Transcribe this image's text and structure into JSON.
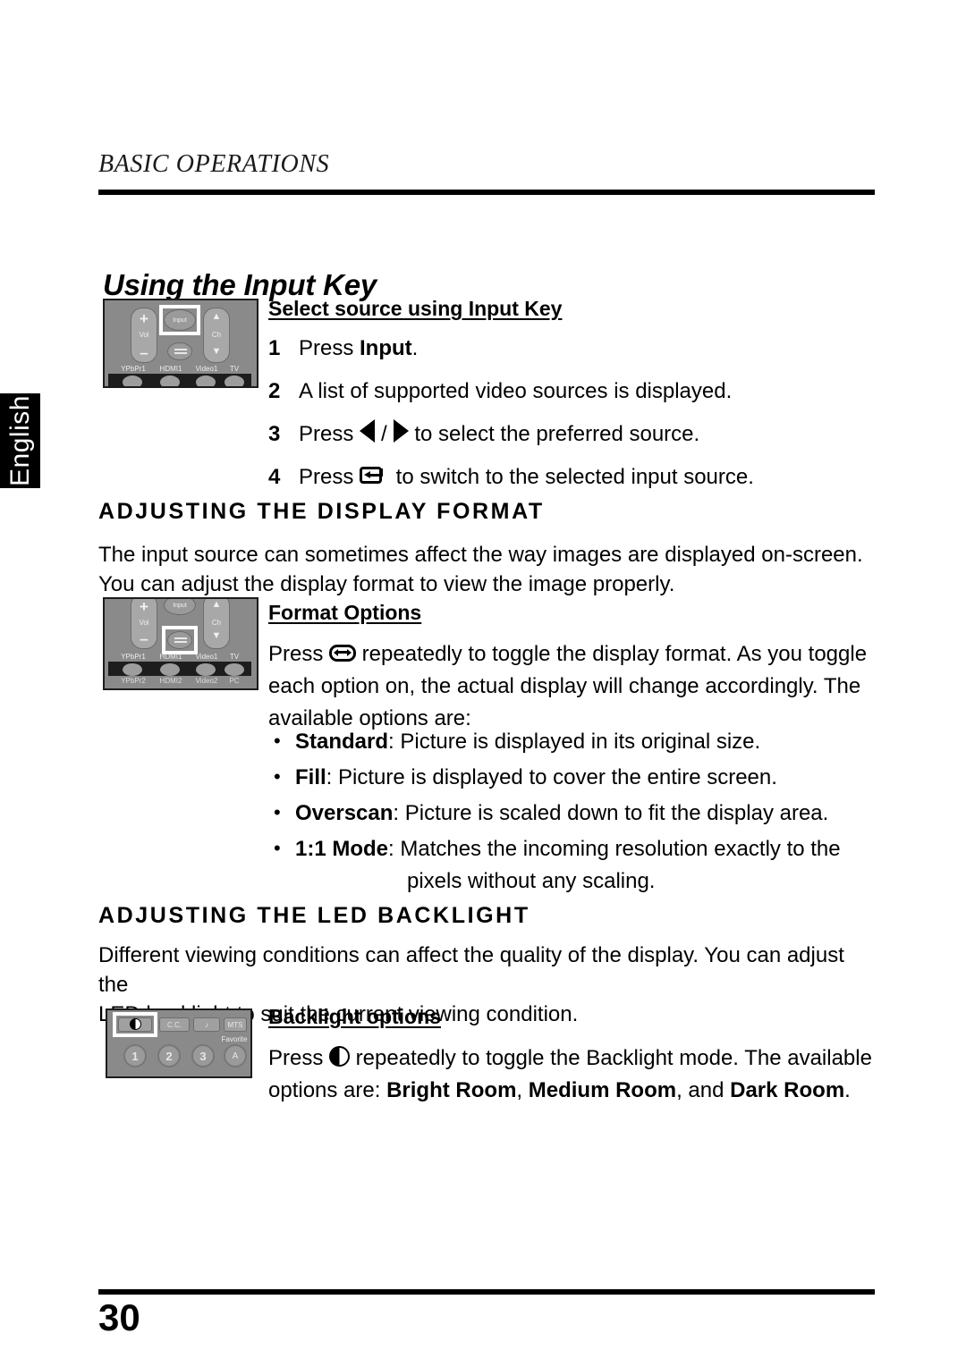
{
  "side_tab": {
    "language": "English"
  },
  "header": {
    "running_head": "BASIC OPERATIONS"
  },
  "title": "Using the Input Key",
  "input_key_section": {
    "subhead": "Select source using Input Key",
    "steps": [
      {
        "num": "1",
        "pre": "Press ",
        "bold": "Input",
        "post": "."
      },
      {
        "num": "2",
        "pre": "A list of supported video sources is displayed.",
        "bold": "",
        "post": ""
      },
      {
        "num": "3",
        "pre": "Press ",
        "icon": "left-right-triangles",
        "post": " to select the preferred source."
      },
      {
        "num": "4",
        "pre": "Press ",
        "icon": "enter-key",
        "post": " to switch to the selected input source."
      }
    ]
  },
  "display_format_section": {
    "heading": "ADJUSTING THE DISPLAY FORMAT",
    "intro_line1": "The input source can sometimes affect the way images are displayed on-screen.",
    "intro_line2": "You can adjust the display format to view the image properly.",
    "subhead": "Format Options",
    "press_pre": "Press ",
    "press_post_line1": " repeatedly to toggle the display format. As you toggle",
    "press_post_line2": "each option on, the actual display will change accordingly. The",
    "press_post_line3": "available options are:",
    "options": [
      {
        "name": "Standard",
        "desc": ": Picture is displayed in its original size.",
        "cont": ""
      },
      {
        "name": "Fill",
        "desc": ": Picture is displayed to cover the entire screen.",
        "cont": ""
      },
      {
        "name": "Overscan",
        "desc": ": Picture is scaled down to fit the display area.",
        "cont": ""
      },
      {
        "name": "1:1 Mode",
        "desc": ": Matches the incoming resolution exactly to the",
        "cont": "pixels without any scaling."
      }
    ]
  },
  "backlight_section": {
    "heading": "ADJUSTING THE LED BACKLIGHT",
    "intro_line1": "Different viewing conditions can affect the quality of the display. You can adjust the",
    "intro_line2": "LED backlight to suit the current viewing condition.",
    "subhead": "Backlight options",
    "press_pre": "Press ",
    "press_post_line1": " repeatedly to toggle the Backlight mode. The available",
    "press_post_line2_pre": "options are: ",
    "mode1": "Bright Room",
    "sep1": ", ",
    "mode2": "Medium Room",
    "sep2": ", and ",
    "mode3": "Dark Room",
    "end": "."
  },
  "remote_input": {
    "vol_plus": "+",
    "vol_label": "Vol",
    "vol_minus": "–",
    "input_btn": "Input",
    "ch_up": "▲",
    "ch_label": "Ch",
    "ch_down": "▼",
    "source_labels": [
      "YPbPr1",
      "HDMI1",
      "Video1",
      "TV"
    ]
  },
  "remote_format": {
    "vol_plus": "+",
    "vol_label": "Vol",
    "vol_minus": "–",
    "input_btn": "Input",
    "ch_up": "▲",
    "ch_label": "Ch",
    "ch_down": "▼",
    "source_labels_top": [
      "YPbPr1",
      "HDMI1",
      "Video1",
      "TV"
    ],
    "source_labels_bottom": [
      "YPbPr2",
      "HDMI2",
      "Video2",
      "PC"
    ]
  },
  "remote_backlight": {
    "keys": [
      "",
      "C.C.",
      "♪",
      "MTS"
    ],
    "favorite_label": "Favorite",
    "numbers": [
      "1",
      "2",
      "3",
      "A"
    ]
  },
  "footer": {
    "page_number": "30"
  }
}
